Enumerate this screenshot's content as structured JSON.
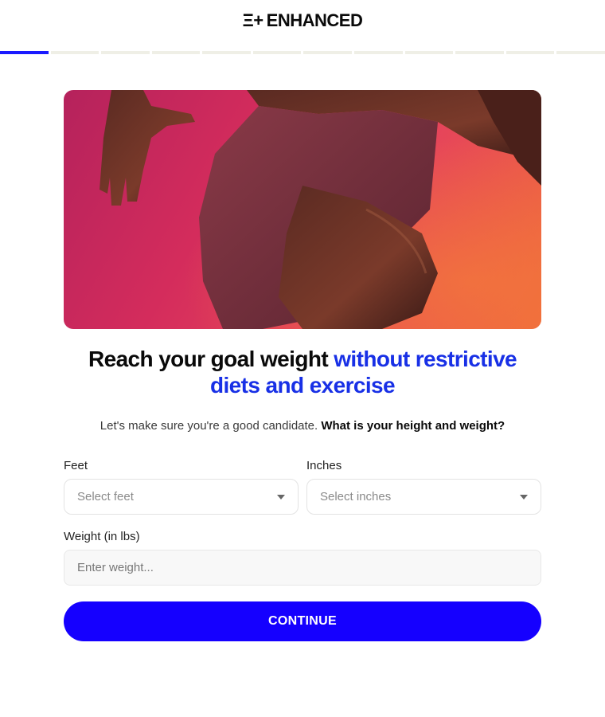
{
  "brand": {
    "mark": "Ξ+",
    "name": "ENHANCED"
  },
  "progress": {
    "total_steps": 12,
    "current_step": 1
  },
  "headline": {
    "plain": "Reach your goal weight ",
    "accent": "without restrictive diets and exercise"
  },
  "subtext": {
    "plain": "Let's make sure you're a good candidate. ",
    "bold": "What is your height and weight?"
  },
  "form": {
    "feet": {
      "label": "Feet",
      "placeholder": "Select feet"
    },
    "inches": {
      "label": "Inches",
      "placeholder": "Select inches"
    },
    "weight": {
      "label": "Weight (in lbs)",
      "placeholder": "Enter weight..."
    }
  },
  "continue_label": "CONTINUE",
  "colors": {
    "accent": "#1830e6",
    "button": "#1500ff",
    "progress_active": "#1a1aff"
  }
}
